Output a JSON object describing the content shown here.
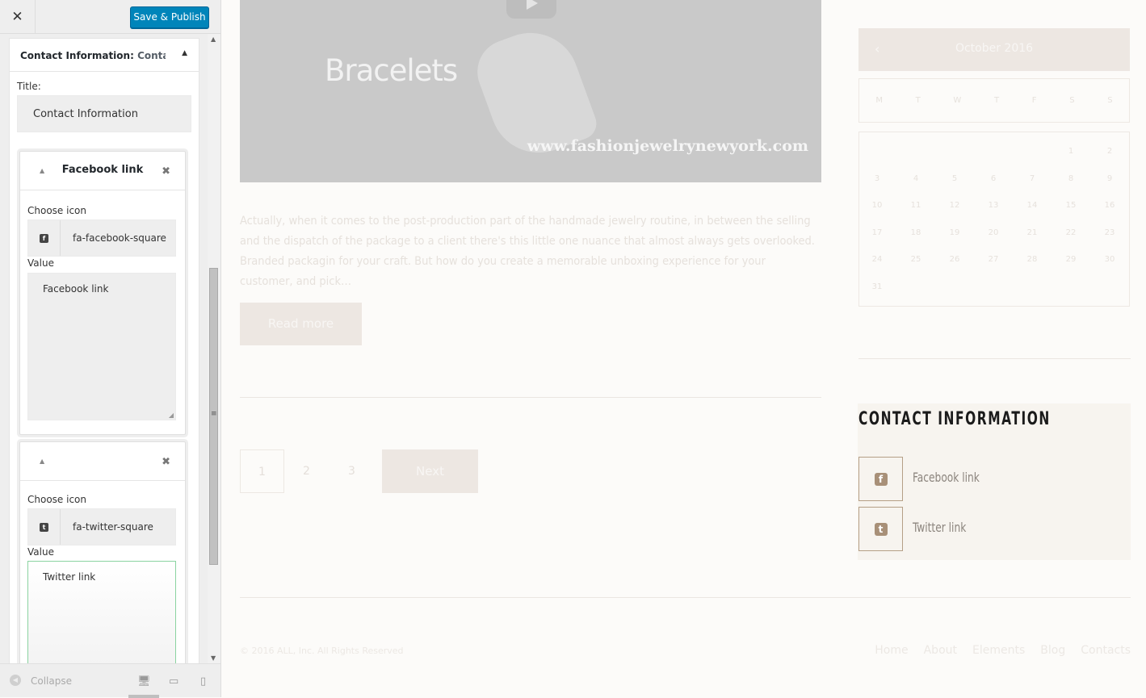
{
  "sidebar": {
    "close_icon": "close-icon",
    "publish_label": "Save & Publish",
    "widget": {
      "title_main": "Contact Information:",
      "title_extra": "Contact…",
      "title_label": "Title:",
      "title_value": "Contact Information",
      "items": [
        {
          "title": "Facebook link",
          "choose_icon_label": "Choose icon",
          "icon_glyph": "f",
          "icon_name": "fa-facebook-square",
          "value_label": "Value",
          "value": "Facebook link"
        },
        {
          "title": "",
          "choose_icon_label": "Choose icon",
          "icon_glyph": "t",
          "icon_name": "fa-twitter-square",
          "value_label": "Value",
          "value": "Twitter link"
        }
      ]
    },
    "footer": {
      "collapse_label": "Collapse"
    }
  },
  "preview": {
    "video": {
      "title": "Bracelets",
      "url": "www.fashionjewelrynewyork.com"
    },
    "excerpt": "Actually, when it comes to the post-production part of the handmade jewelry routine, in between the selling and the dispatch of the package to a client there's this little one nuance that almost always gets overlooked. Branded packagin for your craft. But how do you create a memorable unboxing experience for your customer, and pick…",
    "read_more_label": "Read more",
    "pagination": {
      "pages": [
        "1",
        "2",
        "3"
      ],
      "next_label": "Next"
    },
    "calendar": {
      "month": "October 2016",
      "weekdays": [
        "M",
        "T",
        "W",
        "T",
        "F",
        "S",
        "S"
      ],
      "days": [
        "1",
        "2",
        "3",
        "4",
        "5",
        "6",
        "7",
        "8",
        "9",
        "10",
        "11",
        "12",
        "13",
        "14",
        "15",
        "16",
        "17",
        "18",
        "19",
        "20",
        "21",
        "22",
        "23",
        "24",
        "25",
        "26",
        "27",
        "28",
        "29",
        "30",
        "31"
      ]
    },
    "contact_widget": {
      "title": "CONTACT INFORMATION",
      "links": [
        {
          "icon": "facebook-square-icon",
          "glyph": "f",
          "label": "Facebook link"
        },
        {
          "icon": "twitter-square-icon",
          "glyph": "t",
          "label": "Twitter link"
        }
      ]
    },
    "footer": {
      "copyright": "© 2016 ALL, Inc. All Rights Reserved",
      "nav": [
        "Home",
        "About",
        "Elements",
        "Blog",
        "Contacts"
      ]
    }
  },
  "colors": {
    "publish_blue": "#0085ba",
    "contact_border": "#b59f86",
    "focus_green": "#8ad3a0"
  }
}
